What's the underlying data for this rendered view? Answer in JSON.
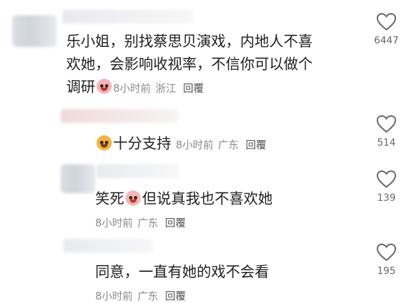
{
  "comments": [
    {
      "text_line1": "乐小姐，别找蔡思贝演戏，内地人不喜",
      "text_line2": "欢她，会影响收视率，不信你可以做个",
      "text_line3": "调研",
      "emoji": "crying-laughing-emoji",
      "time": "8小时前",
      "location": "浙江",
      "reply": "回覆",
      "likes": "6447"
    },
    {
      "emoji": "thumbs-up-emoji",
      "text": "十分支持",
      "time": "8小时前",
      "location": "广东",
      "reply": "回覆",
      "likes": "514"
    },
    {
      "text_before": "笑死",
      "emoji": "crying-laughing-emoji",
      "text_after": "但说真我也不喜欢她",
      "time": "8小时前",
      "location": "广东",
      "reply": "回覆",
      "likes": "139"
    },
    {
      "text": "同意，一直有她的戏不会看",
      "time": "8小时前",
      "location": "广东",
      "reply": "回覆",
      "likes": "195"
    }
  ]
}
